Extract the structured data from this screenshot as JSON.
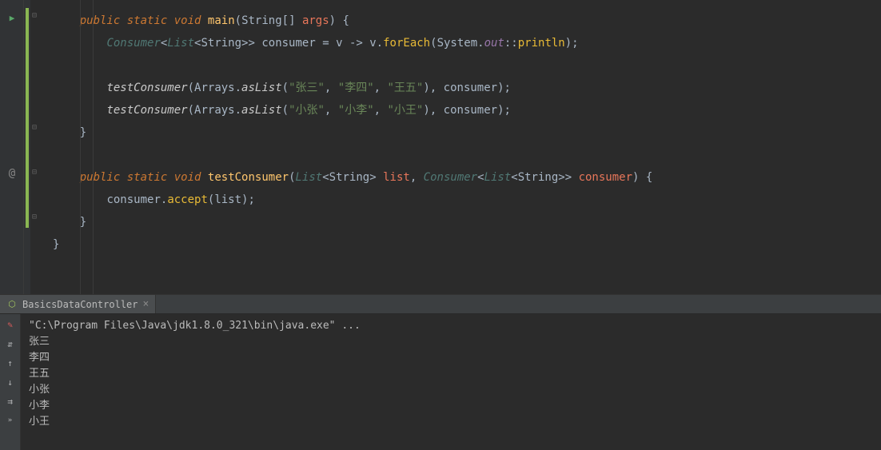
{
  "editor": {
    "lines": [
      {
        "indent": 0,
        "tokens": [
          {
            "t": "kw",
            "v": "public"
          },
          {
            "t": "sp",
            "v": " "
          },
          {
            "t": "kw",
            "v": "static"
          },
          {
            "t": "sp",
            "v": " "
          },
          {
            "t": "kw",
            "v": "void"
          },
          {
            "t": "sp",
            "v": " "
          },
          {
            "t": "method",
            "v": "main"
          },
          {
            "t": "punc",
            "v": "("
          },
          {
            "t": "ident",
            "v": "String"
          },
          {
            "t": "punc",
            "v": "[] "
          },
          {
            "t": "param",
            "v": "args"
          },
          {
            "t": "punc",
            "v": ") {"
          }
        ]
      },
      {
        "indent": 1,
        "tokens": [
          {
            "t": "type",
            "v": "Consumer"
          },
          {
            "t": "generic",
            "v": "<"
          },
          {
            "t": "type",
            "v": "List"
          },
          {
            "t": "generic",
            "v": "<"
          },
          {
            "t": "ident",
            "v": "String"
          },
          {
            "t": "generic",
            "v": ">> "
          },
          {
            "t": "var",
            "v": "consumer"
          },
          {
            "t": "punc",
            "v": " = "
          },
          {
            "t": "var",
            "v": "v"
          },
          {
            "t": "punc",
            "v": " -> "
          },
          {
            "t": "var",
            "v": "v"
          },
          {
            "t": "punc",
            "v": "."
          },
          {
            "t": "method-call",
            "v": "forEach"
          },
          {
            "t": "punc",
            "v": "("
          },
          {
            "t": "ident",
            "v": "System"
          },
          {
            "t": "punc",
            "v": "."
          },
          {
            "t": "static-field",
            "v": "out"
          },
          {
            "t": "punc",
            "v": "::"
          },
          {
            "t": "method-call",
            "v": "println"
          },
          {
            "t": "punc",
            "v": ");"
          }
        ]
      },
      {
        "indent": 1,
        "tokens": []
      },
      {
        "indent": 1,
        "tokens": [
          {
            "t": "static-method",
            "v": "testConsumer"
          },
          {
            "t": "punc",
            "v": "("
          },
          {
            "t": "ident",
            "v": "Arrays"
          },
          {
            "t": "punc",
            "v": "."
          },
          {
            "t": "static-method",
            "v": "asList"
          },
          {
            "t": "punc",
            "v": "("
          },
          {
            "t": "str",
            "v": "\"张三\""
          },
          {
            "t": "punc",
            "v": ", "
          },
          {
            "t": "str",
            "v": "\"李四\""
          },
          {
            "t": "punc",
            "v": ", "
          },
          {
            "t": "str",
            "v": "\"王五\""
          },
          {
            "t": "punc",
            "v": "), "
          },
          {
            "t": "var",
            "v": "consumer"
          },
          {
            "t": "punc",
            "v": ");"
          }
        ]
      },
      {
        "indent": 1,
        "tokens": [
          {
            "t": "static-method",
            "v": "testConsumer"
          },
          {
            "t": "punc",
            "v": "("
          },
          {
            "t": "ident",
            "v": "Arrays"
          },
          {
            "t": "punc",
            "v": "."
          },
          {
            "t": "static-method",
            "v": "asList"
          },
          {
            "t": "punc",
            "v": "("
          },
          {
            "t": "str",
            "v": "\"小张\""
          },
          {
            "t": "punc",
            "v": ", "
          },
          {
            "t": "str",
            "v": "\"小李\""
          },
          {
            "t": "punc",
            "v": ", "
          },
          {
            "t": "str",
            "v": "\"小王\""
          },
          {
            "t": "punc",
            "v": "), "
          },
          {
            "t": "var",
            "v": "consumer"
          },
          {
            "t": "punc",
            "v": ");"
          }
        ]
      },
      {
        "indent": 0,
        "tokens": [
          {
            "t": "punc",
            "v": "}"
          }
        ]
      },
      {
        "indent": 0,
        "tokens": []
      },
      {
        "indent": 0,
        "tokens": [
          {
            "t": "kw",
            "v": "public"
          },
          {
            "t": "sp",
            "v": " "
          },
          {
            "t": "kw",
            "v": "static"
          },
          {
            "t": "sp",
            "v": " "
          },
          {
            "t": "kw",
            "v": "void"
          },
          {
            "t": "sp",
            "v": " "
          },
          {
            "t": "method",
            "v": "testConsumer"
          },
          {
            "t": "punc",
            "v": "("
          },
          {
            "t": "type",
            "v": "List"
          },
          {
            "t": "generic",
            "v": "<"
          },
          {
            "t": "ident",
            "v": "String"
          },
          {
            "t": "generic",
            "v": "> "
          },
          {
            "t": "param",
            "v": "list"
          },
          {
            "t": "punc",
            "v": ", "
          },
          {
            "t": "type",
            "v": "Consumer"
          },
          {
            "t": "generic",
            "v": "<"
          },
          {
            "t": "type",
            "v": "List"
          },
          {
            "t": "generic",
            "v": "<"
          },
          {
            "t": "ident",
            "v": "String"
          },
          {
            "t": "generic",
            "v": ">> "
          },
          {
            "t": "param",
            "v": "consumer"
          },
          {
            "t": "punc",
            "v": ") {"
          }
        ]
      },
      {
        "indent": 1,
        "tokens": [
          {
            "t": "var",
            "v": "consumer"
          },
          {
            "t": "punc",
            "v": "."
          },
          {
            "t": "method-call",
            "v": "accept"
          },
          {
            "t": "punc",
            "v": "("
          },
          {
            "t": "var",
            "v": "list"
          },
          {
            "t": "punc",
            "v": ");"
          }
        ]
      },
      {
        "indent": 0,
        "tokens": [
          {
            "t": "punc",
            "v": "}"
          }
        ]
      },
      {
        "indent": -1,
        "tokens": [
          {
            "t": "punc",
            "v": "}"
          }
        ]
      }
    ]
  },
  "tab": {
    "label": "BasicsDataController"
  },
  "console": {
    "command": "\"C:\\Program Files\\Java\\jdk1.8.0_321\\bin\\java.exe\" ...",
    "output": [
      "张三",
      "李四",
      "王五",
      "小张",
      "小李",
      "小王"
    ]
  }
}
